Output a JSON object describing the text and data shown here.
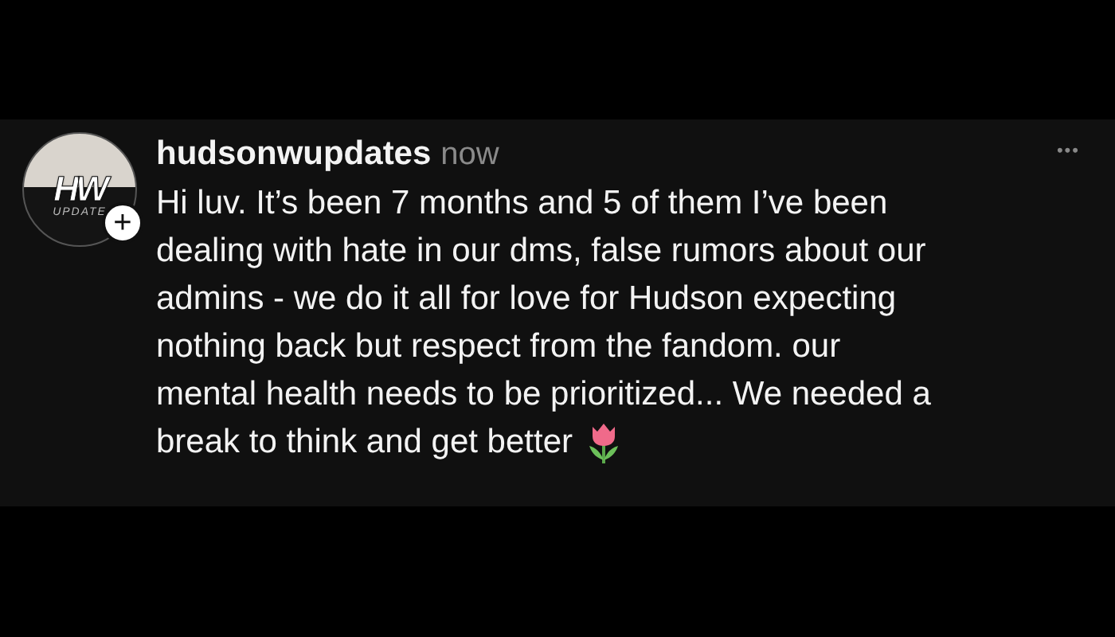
{
  "post": {
    "avatar": {
      "logo": "HW",
      "caption": "UPDATE",
      "follow": "+"
    },
    "username": "hudsonwupdates",
    "time": "now",
    "more": "•••",
    "lines": [
      "Hi luv. It’s been 7 months and 5 of them I’ve been",
      "dealing with hate in our dms, false rumors about our",
      "admins - we do it all for love for Hudson expecting",
      "nothing back but respect from the fandom. our",
      "mental health needs to be prioritized... We needed a",
      "break to think and get better"
    ]
  }
}
